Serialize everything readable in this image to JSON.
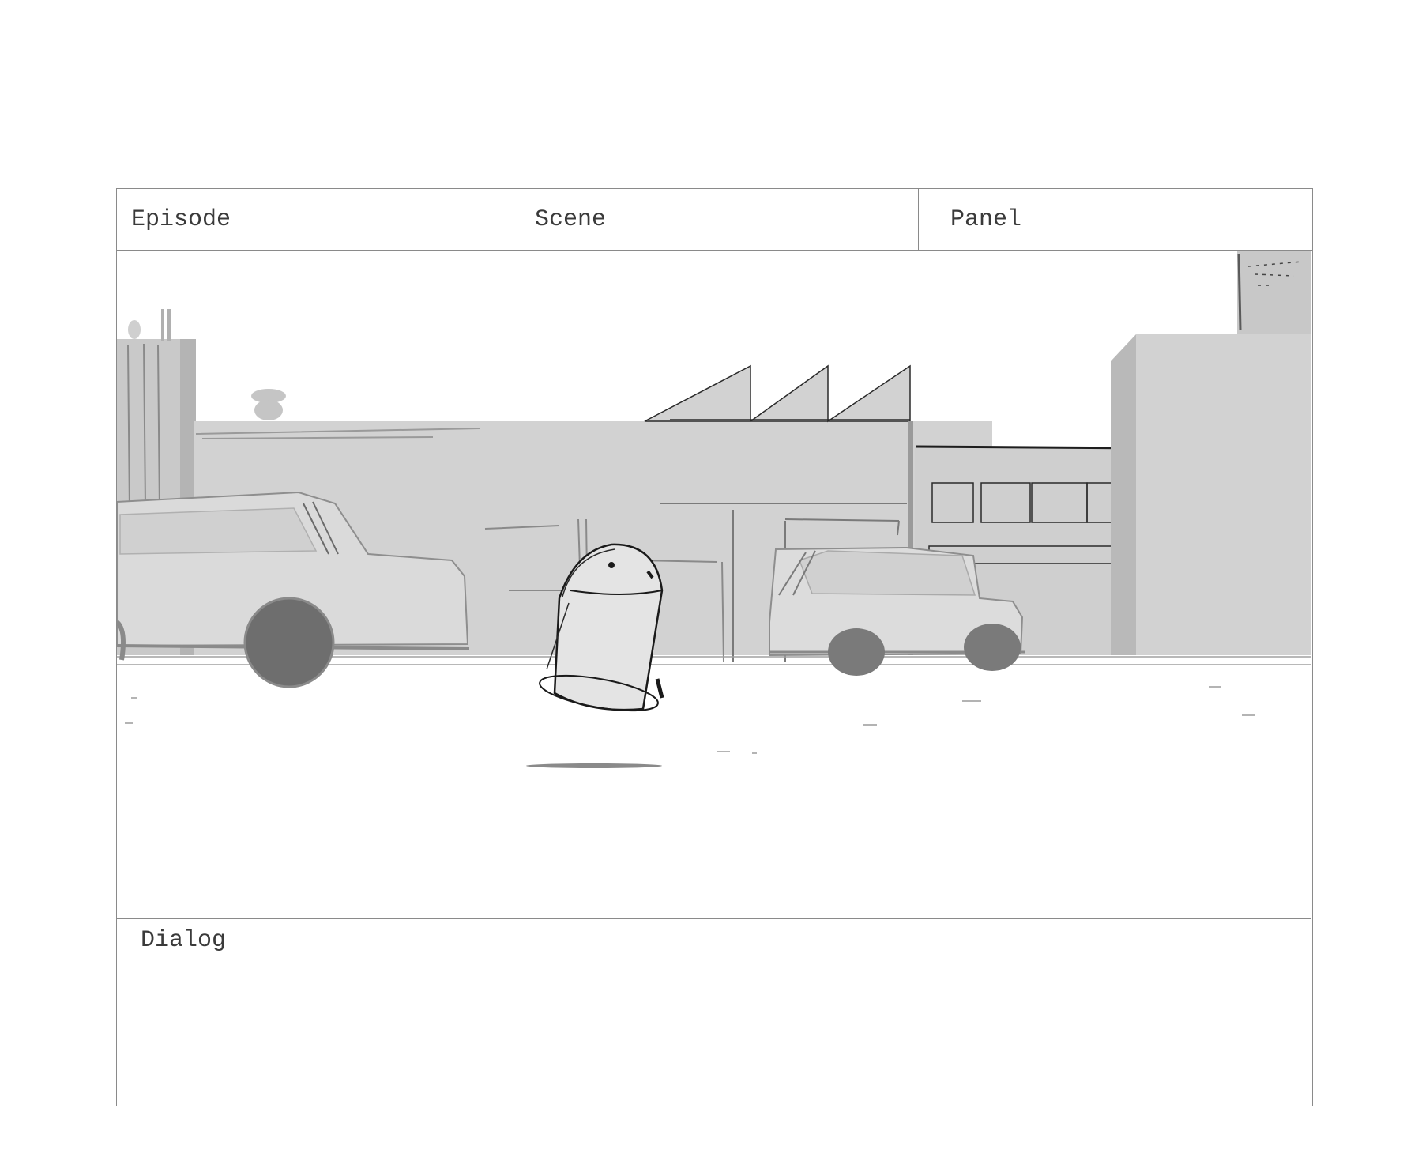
{
  "header": {
    "episode_label": "Episode",
    "scene_label": "Scene",
    "panel_label": "Panel"
  },
  "dialog": {
    "label": "Dialog"
  },
  "colors": {
    "border": "#8a8a8a",
    "building_fill": "#d2d2d2",
    "car_fill": "#dadada",
    "wheel_fill": "#6e6e6e",
    "ink": "#1a1a1a"
  }
}
